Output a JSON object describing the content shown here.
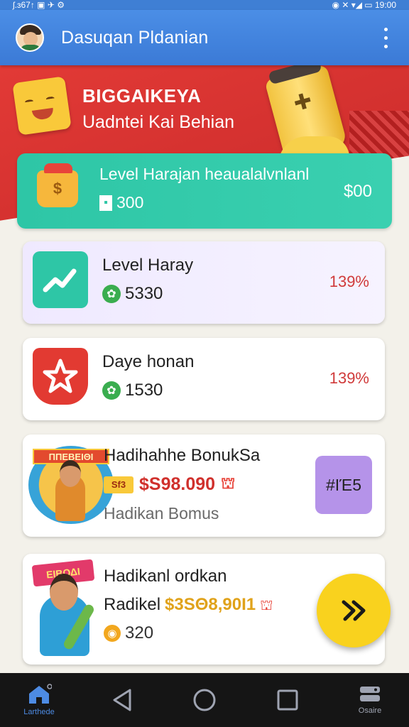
{
  "status_bar": {
    "left": "ʃ.ɜ67↑  ▣  ✈  ⚙",
    "right": "◉  ✕  ▾◢  ▭  19:00"
  },
  "app_bar": {
    "title": "Dasuqan Pldanian"
  },
  "hero": {
    "title": "BΙGGAIKEYA",
    "subtitle": "Uadntei Kai Behian"
  },
  "featured": {
    "title": "Level Harajan heaualalvnlanl",
    "points": "300",
    "amount": "$00",
    "gift_label": "$"
  },
  "cards": [
    {
      "title": "Level Haray",
      "coins": "5330",
      "percent": "139%",
      "color": "#2ec6a6"
    },
    {
      "title": "Daye honan",
      "coins": "1530",
      "percent": "139%",
      "color": "#e23a32"
    }
  ],
  "bonus": {
    "title": "Hadihahhe BonukSa",
    "price": "$S98.090",
    "tag": "Sf3",
    "label": "Hadikan Bomus",
    "badge": "#ΙΈ5",
    "banner": "ΠΠΕΒΕΙΘΙ"
  },
  "reward": {
    "title": "Hadikanl ordkan",
    "prefix": "Radikel",
    "price": "$3SΘ8,90Ι1",
    "coins": "320",
    "banner": "ΕΙΒΟΔΙ"
  },
  "nav": {
    "home": "Larthede",
    "more": "Osaire"
  },
  "colors": {
    "app_bar": "#3b7ad6",
    "hero": "#e23a36",
    "featured": "#2ec6a6",
    "fab": "#f9d21e"
  }
}
